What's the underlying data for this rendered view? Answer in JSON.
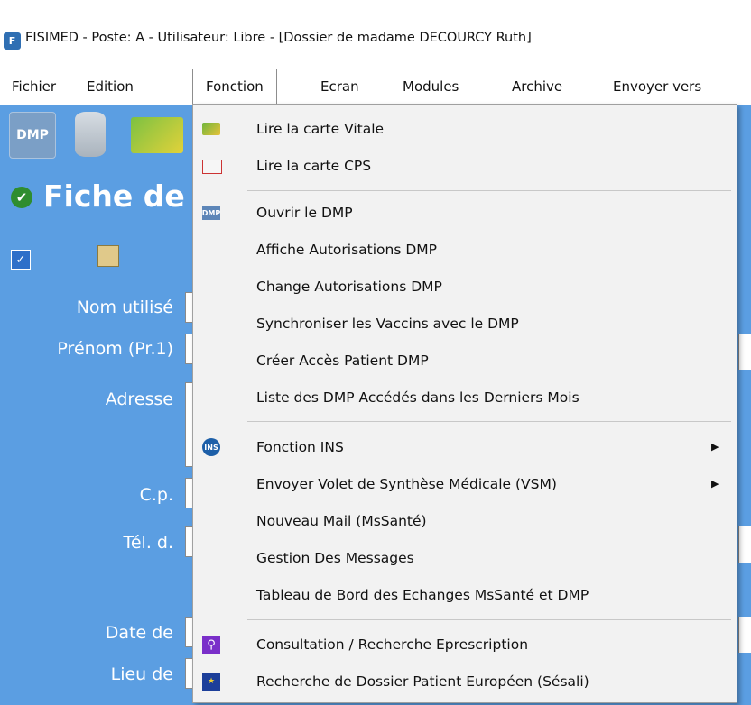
{
  "window": {
    "title": "FISIMED - Poste: A - Utilisateur: Libre - [Dossier de madame DECOURCY Ruth]",
    "app_icon": "F"
  },
  "menubar": {
    "items": [
      "Fichier",
      "Edition",
      "Fonction",
      "Ecran",
      "Modules",
      "Archive",
      "Envoyer vers"
    ]
  },
  "toolbar": {
    "dmp_label": "DMP"
  },
  "fiche": {
    "title": "Fiche de",
    "labels": [
      "Nom utilisé",
      "Prénom (Pr.1)",
      "Adresse",
      "C.p.",
      "Tél. d.",
      "Date de",
      "Lieu de"
    ]
  },
  "menu": {
    "items": [
      {
        "label": "Lire la carte Vitale",
        "icon": "vitale-card-icon"
      },
      {
        "label": "Lire la carte CPS",
        "icon": "cps-card-icon"
      },
      {
        "label": "Ouvrir le DMP",
        "icon": "dmp-icon"
      },
      {
        "label": "Affiche Autorisations DMP"
      },
      {
        "label": "Change Autorisations DMP"
      },
      {
        "label": "Synchroniser les Vaccins avec le DMP"
      },
      {
        "label": "Créer Accès Patient DMP"
      },
      {
        "label": "Liste des DMP Accédés dans les Derniers Mois"
      },
      {
        "label": "Fonction INS",
        "icon": "ins-icon",
        "submenu": true
      },
      {
        "label": "Envoyer Volet de Synthèse Médicale (VSM)",
        "submenu": true
      },
      {
        "label": "Nouveau Mail (MsSanté)"
      },
      {
        "label": "Gestion Des Messages"
      },
      {
        "label": "Tableau de Bord des Echanges MsSanté et DMP"
      },
      {
        "label": "Consultation / Recherche Eprescription",
        "icon": "search-icon"
      },
      {
        "label": "Recherche de Dossier Patient Européen (Sésali)",
        "icon": "eu-flag-icon"
      }
    ],
    "icon_texts": {
      "dmp": "DMP",
      "ins": "INS"
    }
  }
}
